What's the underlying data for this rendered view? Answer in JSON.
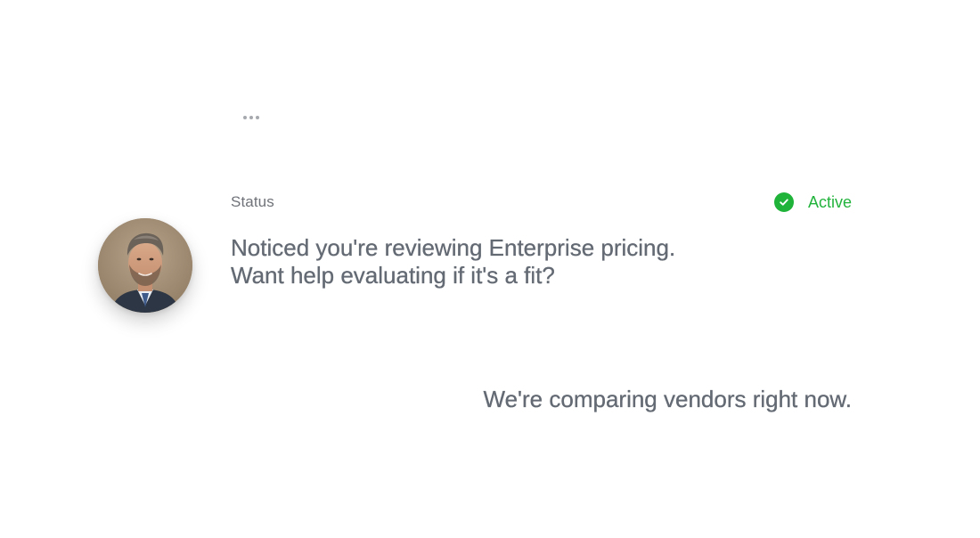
{
  "header": {
    "status_label": "Status",
    "status_value": "Active",
    "status_icon": "check-circle-icon",
    "status_color": "#22b33c"
  },
  "typing_indicator": {
    "icon": "ellipsis-icon"
  },
  "conversation": {
    "agent": {
      "avatar": "avatar-photo",
      "message_lines": [
        "Noticed you're reviewing Enterprise pricing.",
        "Want help evaluating if it's a fit?"
      ]
    },
    "user": {
      "message": "We're comparing vendors right now."
    }
  },
  "colors": {
    "text_primary": "#646a73",
    "text_label": "#6f7278",
    "accent_green": "#1fb33a"
  }
}
